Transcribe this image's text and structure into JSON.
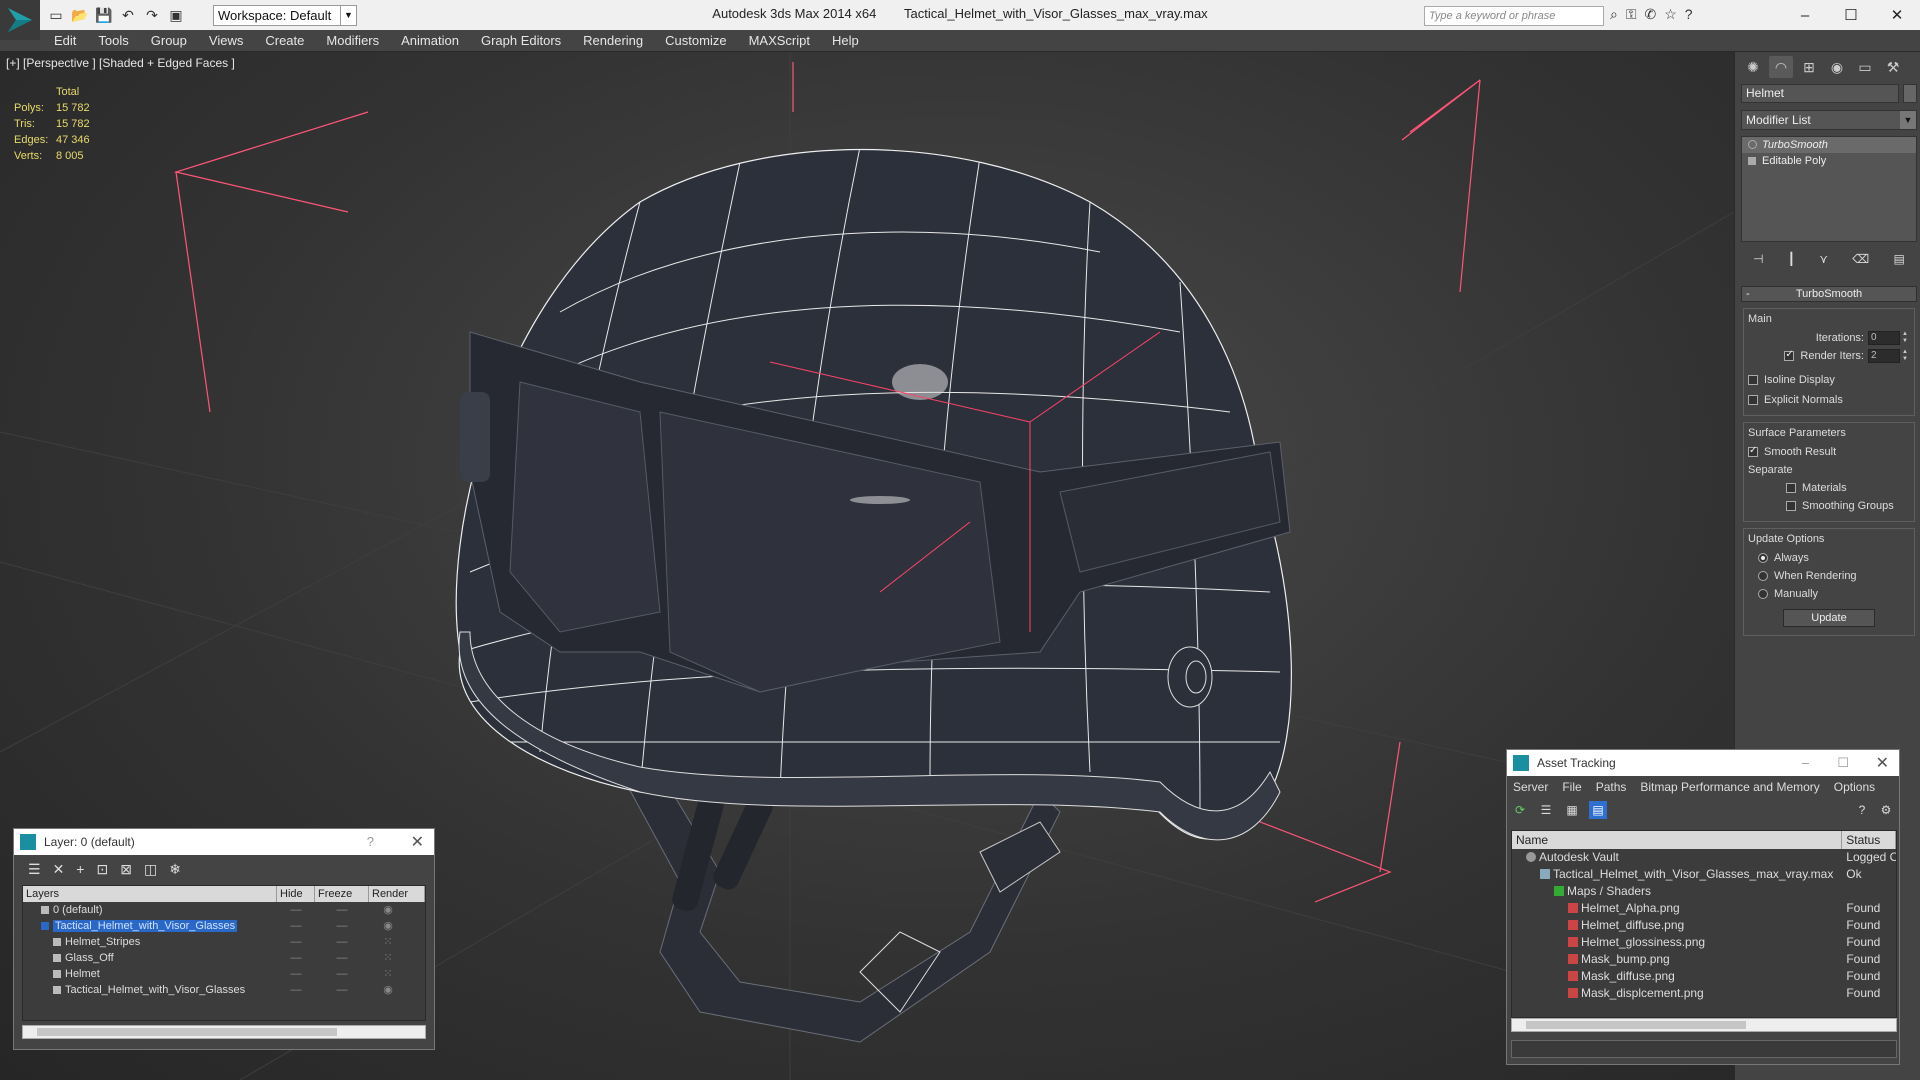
{
  "titlebar": {
    "workspace": "Workspace: Default",
    "app_title": "Autodesk 3ds Max  2014 x64",
    "file_title": "Tactical_Helmet_with_Visor_Glasses_max_vray.max",
    "search_placeholder": "Type a keyword or phrase"
  },
  "menu": [
    "Edit",
    "Tools",
    "Group",
    "Views",
    "Create",
    "Modifiers",
    "Animation",
    "Graph Editors",
    "Rendering",
    "Customize",
    "MAXScript",
    "Help"
  ],
  "viewport": {
    "label": "[+] [Perspective ] [Shaded + Edged Faces ]",
    "stats": {
      "total_label": "Total",
      "rows": [
        {
          "k": "Polys:",
          "v": "15 782"
        },
        {
          "k": "Tris:",
          "v": "15 782"
        },
        {
          "k": "Edges:",
          "v": "47 346"
        },
        {
          "k": "Verts:",
          "v": "8 005"
        }
      ]
    }
  },
  "command_panel": {
    "object_name": "Helmet",
    "modifier_list": "Modifier List",
    "stack": [
      "TurboSmooth",
      "Editable Poly"
    ],
    "rollout_title": "TurboSmooth",
    "main_group": "Main",
    "iterations_label": "Iterations:",
    "iterations_value": "0",
    "render_iters_label": "Render Iters:",
    "render_iters_value": "2",
    "isoline": "Isoline Display",
    "explicit_normals": "Explicit Normals",
    "surface_group": "Surface Parameters",
    "smooth_result": "Smooth Result",
    "separate_label": "Separate",
    "materials": "Materials",
    "smoothing_groups": "Smoothing Groups",
    "update_group": "Update Options",
    "always": "Always",
    "when_rendering": "When Rendering",
    "manually": "Manually",
    "update_button": "Update"
  },
  "layer_dialog": {
    "title": "Layer: 0 (default)",
    "help": "?",
    "columns": [
      "Layers",
      "Hide",
      "Freeze",
      "Render"
    ],
    "rows": [
      {
        "name": "0 (default)",
        "level": 1
      },
      {
        "name": "Tactical_Helmet_with_Visor_Glasses",
        "level": 1
      },
      {
        "name": "Helmet_Stripes",
        "level": 2
      },
      {
        "name": "Glass_Off",
        "level": 2
      },
      {
        "name": "Helmet",
        "level": 2
      },
      {
        "name": "Tactical_Helmet_with_Visor_Glasses",
        "level": 2
      }
    ]
  },
  "asset_dialog": {
    "title": "Asset Tracking",
    "menu": [
      "Server",
      "File",
      "Paths",
      "Bitmap Performance and Memory",
      "Options"
    ],
    "columns": [
      "Name",
      "Status"
    ],
    "rows": [
      {
        "name": "Autodesk Vault",
        "status": "Logged Out",
        "level": 1,
        "icon": "vault-icon"
      },
      {
        "name": "Tactical_Helmet_with_Visor_Glasses_max_vray.max",
        "status": "Ok",
        "level": 2,
        "icon": "max-file-icon"
      },
      {
        "name": "Maps / Shaders",
        "status": "",
        "level": 3,
        "icon": "maps-icon"
      },
      {
        "name": "Helmet_Alpha.png",
        "status": "Found",
        "level": 4,
        "icon": "png-icon"
      },
      {
        "name": "Helmet_diffuse.png",
        "status": "Found",
        "level": 4,
        "icon": "png-icon"
      },
      {
        "name": "Helmet_glossiness.png",
        "status": "Found",
        "level": 4,
        "icon": "png-icon"
      },
      {
        "name": "Mask_bump.png",
        "status": "Found",
        "level": 4,
        "icon": "png-icon"
      },
      {
        "name": "Mask_diffuse.png",
        "status": "Found",
        "level": 4,
        "icon": "png-icon"
      },
      {
        "name": "Mask_displcement.png",
        "status": "Found",
        "level": 4,
        "icon": "png-icon"
      }
    ]
  },
  "colors": {
    "viewport_bg": "#333333",
    "stats_text": "#e8d96a",
    "selection": "#2a68c8",
    "wire": "#ffffff",
    "bbox": "#ff5577"
  }
}
